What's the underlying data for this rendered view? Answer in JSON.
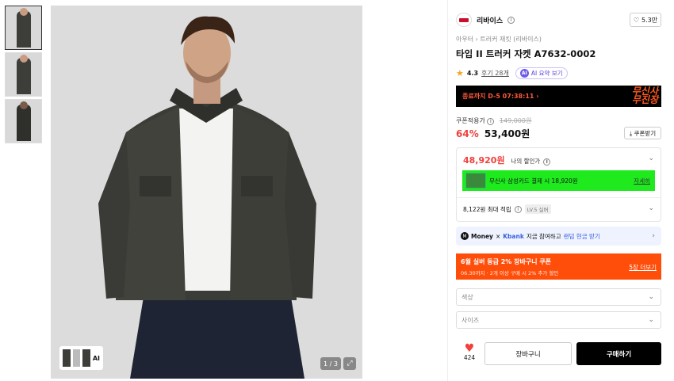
{
  "gallery": {
    "thumbnails": [
      {
        "alt": "thumbnail-1"
      },
      {
        "alt": "thumbnail-2"
      },
      {
        "alt": "thumbnail-3"
      }
    ],
    "ai_chip_label": "AI",
    "pager": "1 / 3"
  },
  "brand": {
    "name": "리바이스",
    "like_count": "5.3만"
  },
  "breadcrumb": "아우터 › 트러커 재킷 (리바이스)",
  "product": {
    "title": "타입 II 트러커 자켓 A7632-0002",
    "rating": "4.3",
    "reviews": "후기 28개",
    "ai_summary": "AI 요약 보기"
  },
  "banner": {
    "text": "종료까지 D-5 07:38:11 ›",
    "art": "무신사\n무진장"
  },
  "price": {
    "label": "쿠폰적용가",
    "original": "149,000원",
    "discount": "64%",
    "final": "53,400원",
    "coupon_button": "⤓ 쿠폰받기"
  },
  "my_price": {
    "amount": "48,920원",
    "label": "나의 할인가",
    "card_offer": "무신사 삼성카드 결제 시 18,920원",
    "card_detail": "자세히",
    "points": "8,122원 최대 적립",
    "level": "LV.5 실버"
  },
  "money": {
    "brand": "Money",
    "bank": "Kbank",
    "text": "지금 참여하고",
    "link": "랜덤 현금 받기"
  },
  "promo": {
    "title": "6월 실버 등급 2% 장바구니 쿠폰",
    "sub": "06.30까지 · 2개 이상 구매 시 2% 추가 할인",
    "more": "5장 더보기"
  },
  "options": {
    "color_placeholder": "색상",
    "size_placeholder": "사이즈"
  },
  "actions": {
    "likes": "424",
    "cart": "장바구니",
    "buy": "구매하기"
  },
  "colors": {
    "accent_red": "#f0413c",
    "promo_orange": "#ff4d0a",
    "card_green": "#1eea1e"
  }
}
